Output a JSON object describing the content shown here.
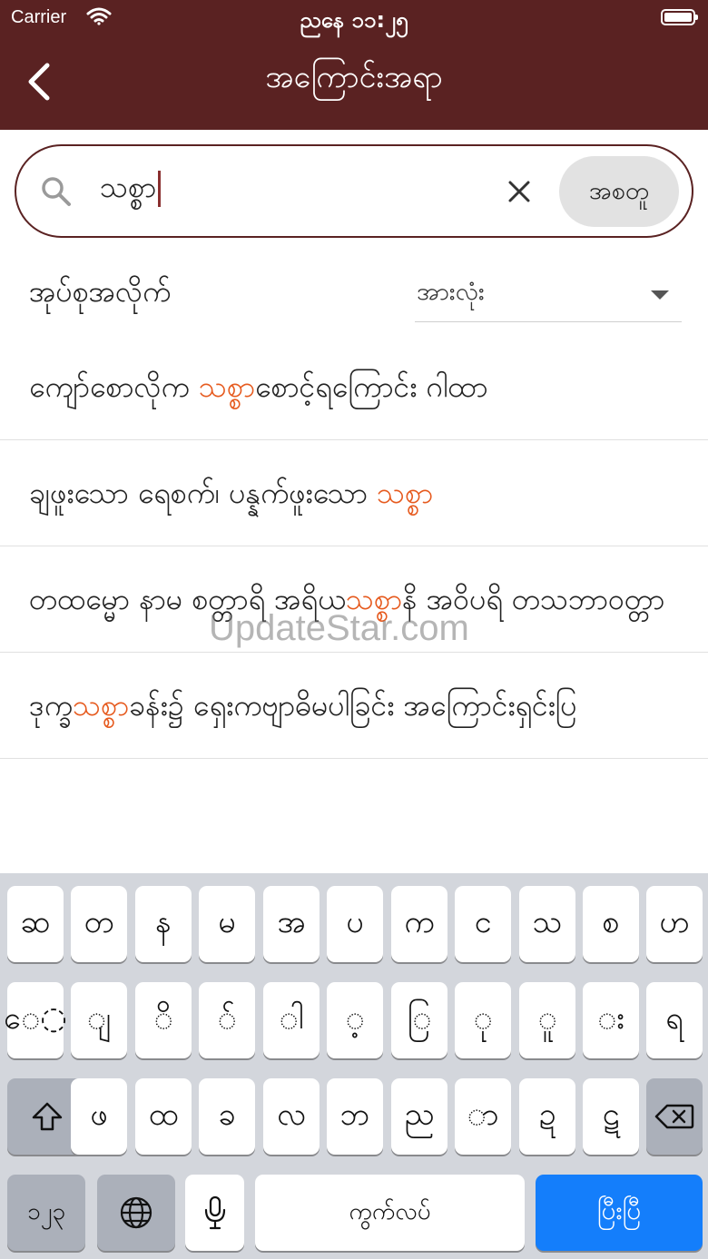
{
  "status_bar": {
    "carrier": "Carrier",
    "time": "ညနေ ၁၁:၂၅"
  },
  "header": {
    "title": "အကြောင်းအရာ"
  },
  "search": {
    "value": "သစ္စာ",
    "button_label": "အစတူ"
  },
  "filter": {
    "label": "အုပ်စုအလိုက်",
    "selected": "အားလုံး"
  },
  "results": [
    {
      "parts": [
        "ကျော်စောလိုက ",
        "သစ္စာ",
        "စောင့်ရကြောင်း ဂါထာ"
      ]
    },
    {
      "parts": [
        "ချဖူးသော ရေစက်၊ ပန္နက်ဖူးသော ",
        "သစ္စာ",
        ""
      ]
    },
    {
      "parts": [
        "တထမ္မော နာမ စတ္တာရိ အရိယ",
        "သစ္စာ",
        "နိ အဝိပရိ တသဘာဝတ္တာ"
      ]
    },
    {
      "parts": [
        "ဒုက္ခ",
        "သစ္စာ",
        "ခန်း၌ ရှေးကဗျာဓိမပါခြင်း အကြောင်းရှင်းပြ"
      ]
    }
  ],
  "watermark": "UpdateStar.com",
  "keyboard": {
    "row1": [
      "ဆ",
      "တ",
      "န",
      "မ",
      "အ",
      "ပ",
      "က",
      "င",
      "သ",
      "စ",
      "ဟ"
    ],
    "row2": [
      "ေ◌",
      "◌ျ",
      "◌ိ",
      "◌်",
      "◌ါ",
      "◌့",
      "◌ြ",
      "◌ု",
      "◌ူ",
      "◌း",
      "ရ"
    ],
    "row3": [
      "ဖ",
      "ထ",
      "ခ",
      "လ",
      "ဘ",
      "ည",
      "◌ာ",
      "ဍ",
      "ဋ"
    ],
    "numbers_key": "၁၂၃",
    "space_label": "ကွက်လပ်",
    "return_label": "ပြီးပြီ"
  },
  "colors": {
    "header_bg": "#5a2222",
    "highlight": "#e65a1e",
    "return_key": "#147efb"
  }
}
